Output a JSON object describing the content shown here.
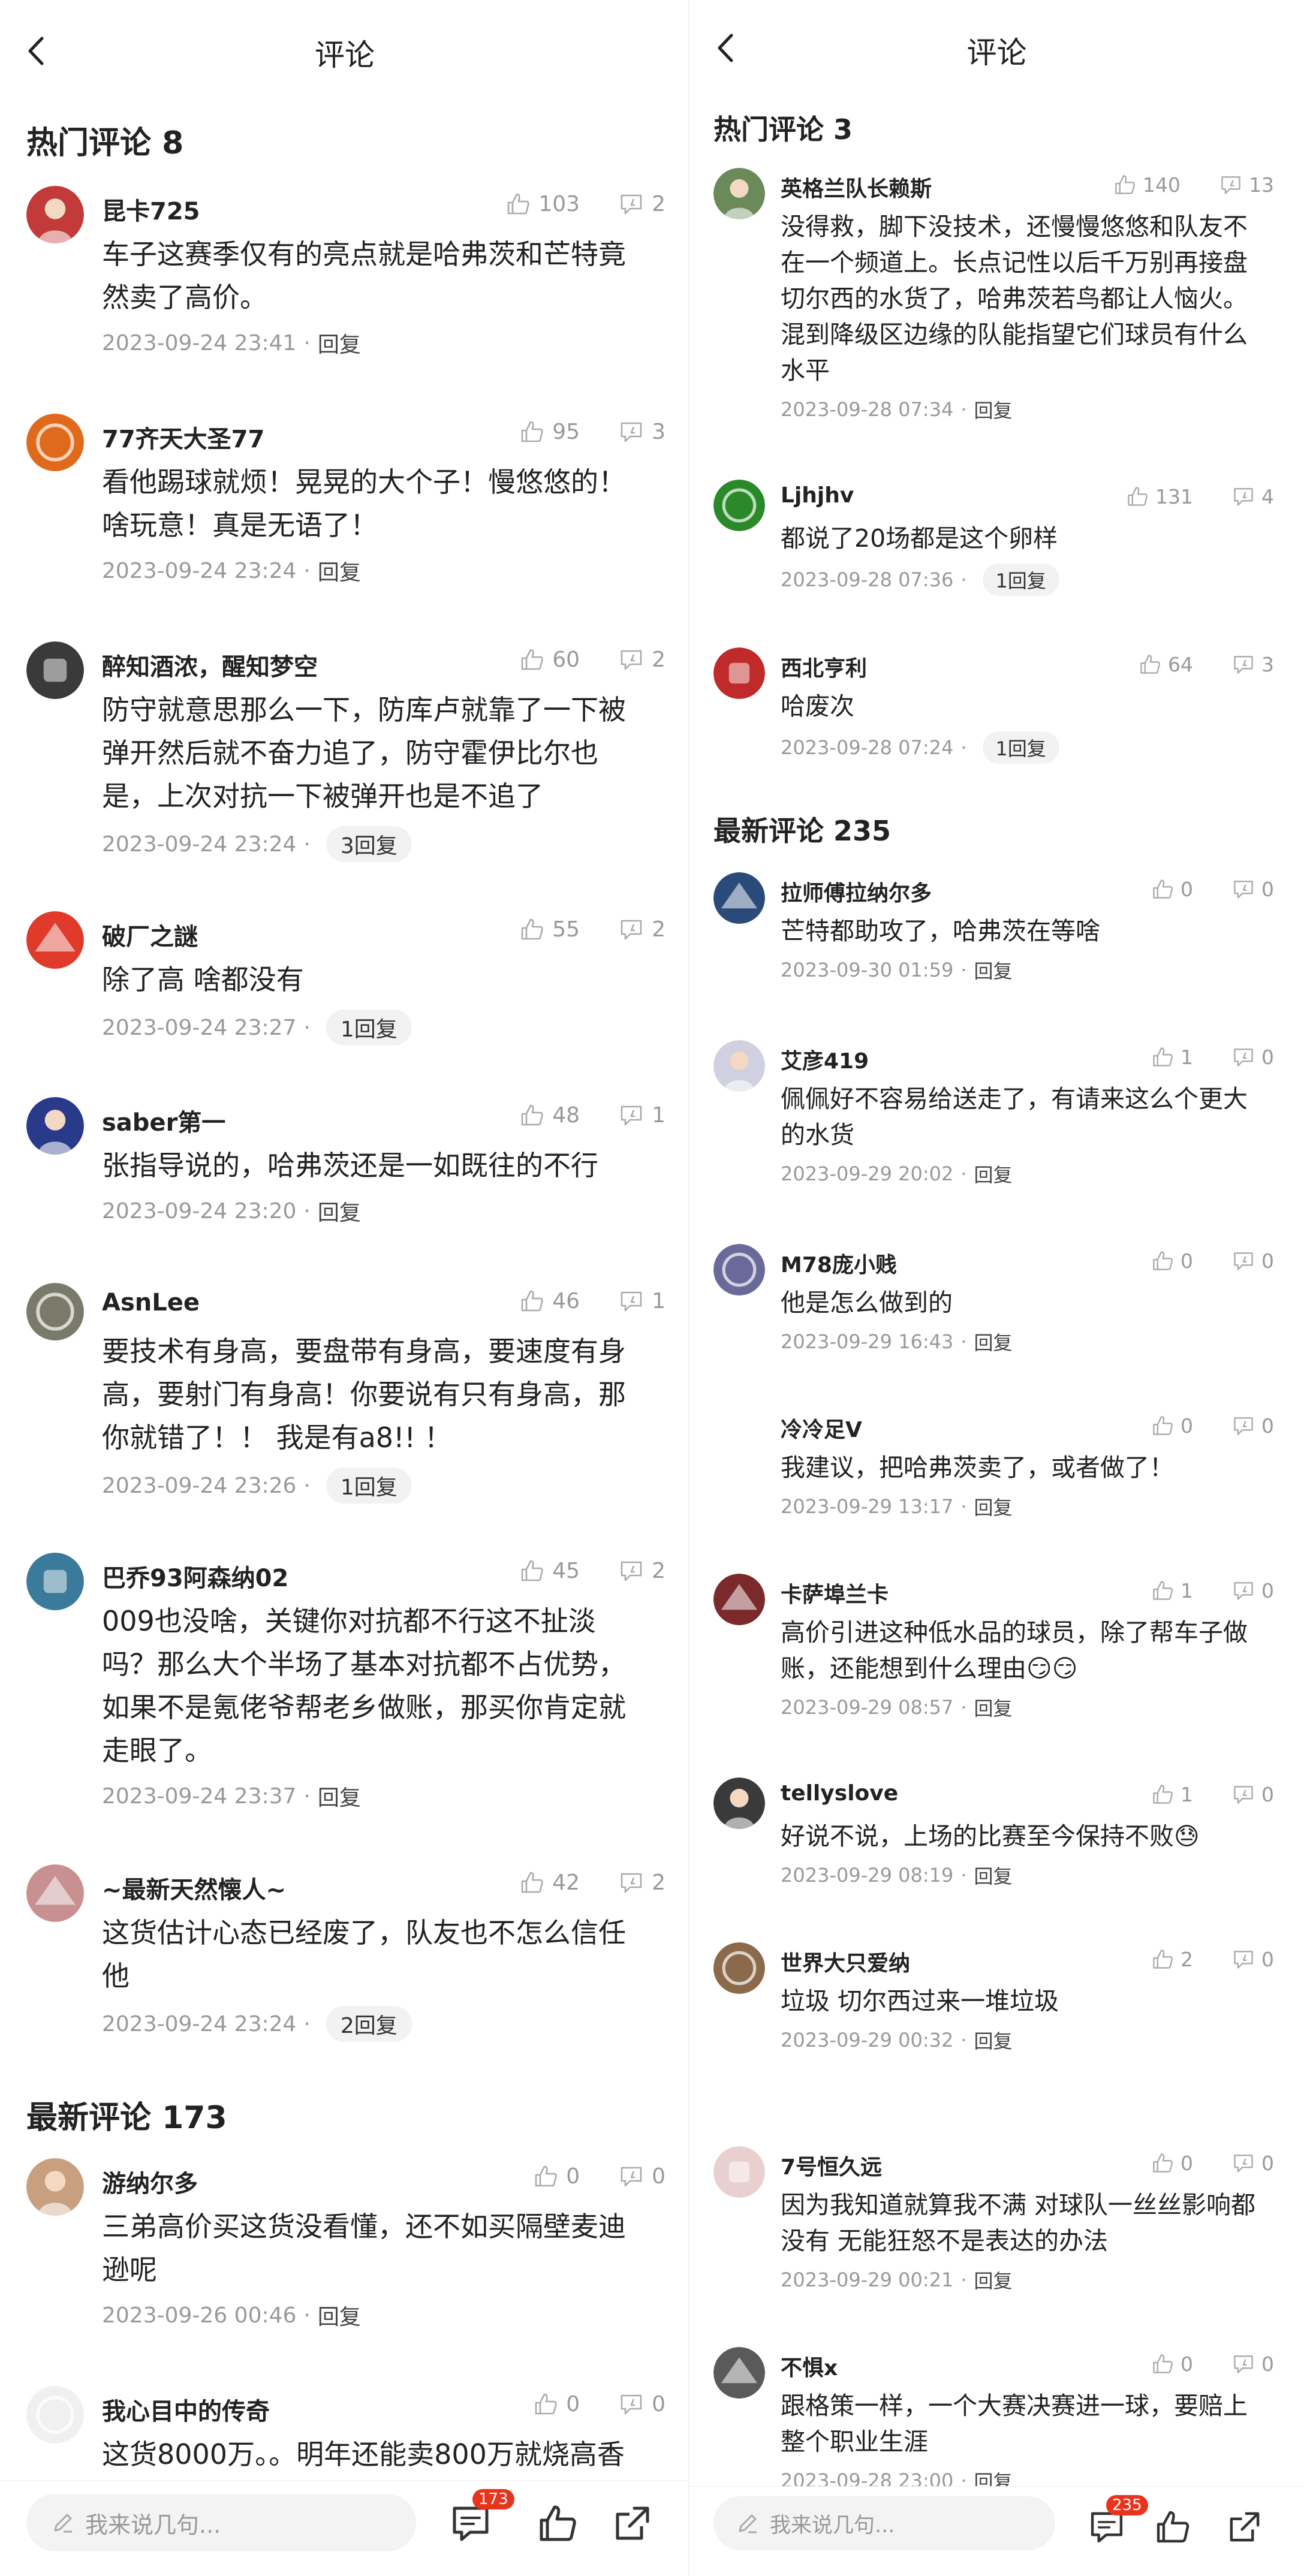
{
  "left": {
    "title": "评论",
    "hot_title": "热门评论 8",
    "new_title": "最新评论 173",
    "hot": [
      {
        "user": "昆卡725",
        "likes": "103",
        "dislikes": "2",
        "lines": [
          "车子这赛季仅有的亮点就是哈弗茨和芒特竟",
          "然卖了高价。"
        ],
        "time": "2023-09-24 23:41",
        "reply": "回复",
        "reply_count": ""
      },
      {
        "user": "77齐天大圣77",
        "likes": "95",
        "dislikes": "3",
        "lines": [
          "看他踢球就烦！晃晃的大个子！慢悠悠的！",
          "啥玩意！真是无语了！"
        ],
        "time": "2023-09-24 23:24",
        "reply": "回复",
        "reply_count": ""
      },
      {
        "user": "醉知酒浓，醒知梦空",
        "likes": "60",
        "dislikes": "2",
        "lines": [
          "防守就意思那么一下，防库卢就靠了一下被",
          "弹开然后就不奋力追了，防守霍伊比尔也",
          "是，上次对抗一下被弹开也是不追了"
        ],
        "time": "2023-09-24 23:24",
        "reply": "",
        "reply_count": "3回复"
      },
      {
        "user": "破厂之謎",
        "likes": "55",
        "dislikes": "2",
        "lines": [
          "除了高 啥都没有"
        ],
        "time": "2023-09-24 23:27",
        "reply": "",
        "reply_count": "1回复"
      },
      {
        "user": "saber第一",
        "likes": "48",
        "dislikes": "1",
        "lines": [
          "张指导说的，哈弗茨还是一如既往的不行"
        ],
        "time": "2023-09-24 23:20",
        "reply": "回复",
        "reply_count": ""
      },
      {
        "user": "AsnLee",
        "likes": "46",
        "dislikes": "1",
        "lines": [
          "要技术有身高，要盘带有身高，要速度有身",
          "高，要射门有身高！你要说有只有身高，那",
          "你就错了！！ 我是有a8!! ！"
        ],
        "time": "2023-09-24 23:26",
        "reply": "",
        "reply_count": "1回复"
      },
      {
        "user": "巴乔93阿森纳02",
        "likes": "45",
        "dislikes": "2",
        "lines": [
          "009也没啥，关键你对抗都不行这不扯淡",
          "吗？那么大个半场了基本对抗都不占优势，",
          "如果不是氪佬爷帮老乡做账，那买你肯定就",
          "走眼了。"
        ],
        "time": "2023-09-24 23:37",
        "reply": "回复",
        "reply_count": ""
      },
      {
        "user": "~最新天然懐人~",
        "likes": "42",
        "dislikes": "2",
        "lines": [
          "这货估计心态已经废了，队友也不怎么信任",
          "他"
        ],
        "time": "2023-09-24 23:24",
        "reply": "",
        "reply_count": "2回复"
      }
    ],
    "new": [
      {
        "user": "游纳尔多",
        "likes": "0",
        "dislikes": "0",
        "lines": [
          "三弟高价买这货没看懂，还不如买隔壁麦迪",
          "逊呢"
        ],
        "time": "2023-09-26 00:46",
        "reply": "回复",
        "reply_count": ""
      },
      {
        "user": "我心目中的传奇",
        "likes": "0",
        "dislikes": "0",
        "lines": [
          "这货8000万。。明年还能卖800万就烧高香"
        ],
        "time": "",
        "reply": "",
        "reply_count": ""
      }
    ],
    "input_placeholder": "我来说几句...",
    "comment_badge": "173"
  },
  "right": {
    "title": "评论",
    "hot_title": "热门评论 3",
    "new_title": "最新评论 235",
    "hot": [
      {
        "user": "英格兰队长赖斯",
        "likes": "140",
        "dislikes": "13",
        "lines": [
          "没得救，脚下没技术，还慢慢悠悠和队友不",
          "在一个频道上。长点记性以后千万别再接盘",
          "切尔西的水货了，哈弗茨若鸟都让人恼火。",
          "混到降级区边缘的队能指望它们球员有什么",
          "水平"
        ],
        "time": "2023-09-28 07:34",
        "reply": "回复",
        "reply_count": ""
      },
      {
        "user": "Ljhjhv",
        "likes": "131",
        "dislikes": "4",
        "lines": [
          "都说了20场都是这个卵样"
        ],
        "time": "2023-09-28 07:36",
        "reply": "",
        "reply_count": "1回复"
      },
      {
        "user": "西北亨利",
        "likes": "64",
        "dislikes": "3",
        "lines": [
          "哈废次"
        ],
        "time": "2023-09-28 07:24",
        "reply": "",
        "reply_count": "1回复"
      }
    ],
    "new": [
      {
        "user": "拉师傅拉纳尔多",
        "likes": "0",
        "dislikes": "0",
        "lines": [
          "芒特都助攻了，哈弗茨在等啥"
        ],
        "time": "2023-09-30 01:59",
        "reply": "回复",
        "reply_count": ""
      },
      {
        "user": "艾彦419",
        "likes": "1",
        "dislikes": "0",
        "lines": [
          "佩佩好不容易给送走了，有请来这么个更大",
          "的水货"
        ],
        "time": "2023-09-29 20:02",
        "reply": "回复",
        "reply_count": ""
      },
      {
        "user": "M78庞小贱",
        "likes": "0",
        "dislikes": "0",
        "lines": [
          "他是怎么做到的"
        ],
        "time": "2023-09-29 16:43",
        "reply": "回复",
        "reply_count": ""
      },
      {
        "user": "冷冷足V",
        "likes": "0",
        "dislikes": "0",
        "lines": [
          "我建议，把哈弗茨卖了，或者做了！"
        ],
        "time": "2023-09-29 13:17",
        "reply": "回复",
        "reply_count": ""
      },
      {
        "user": "卡萨埠兰卡",
        "likes": "1",
        "dislikes": "0",
        "lines": [
          "高价引进这种低水品的球员，除了帮车子做",
          "账，还能想到什么理由😏😏"
        ],
        "time": "2023-09-29 08:57",
        "reply": "回复",
        "reply_count": ""
      },
      {
        "user": "tellyslove",
        "likes": "1",
        "dislikes": "0",
        "lines": [
          "好说不说，上场的比赛至今保持不败😓"
        ],
        "time": "2023-09-29 08:19",
        "reply": "回复",
        "reply_count": ""
      },
      {
        "user": "世界大只爱纳",
        "likes": "2",
        "dislikes": "0",
        "lines": [
          "垃圾 切尔西过来一堆垃圾"
        ],
        "time": "2023-09-29 00:32",
        "reply": "回复",
        "reply_count": ""
      },
      {
        "user": "7号恒久远",
        "likes": "0",
        "dislikes": "0",
        "lines": [
          "因为我知道就算我不满 对球队一丝丝影响都",
          "没有 无能狂怒不是表达的办法"
        ],
        "time": "2023-09-29 00:21",
        "reply": "回复",
        "reply_count": ""
      },
      {
        "user": "不惧x",
        "likes": "0",
        "dislikes": "0",
        "lines": [
          "跟格策一样，一个大赛决赛进一球，要赔上",
          "整个职业生涯"
        ],
        "time": "2023-09-28 23:00",
        "reply": "回复",
        "reply_count": ""
      }
    ],
    "input_placeholder": "我来说几句...",
    "comment_badge": "235"
  },
  "colors": {
    "accent": "#e8341c",
    "muted": "#999999",
    "text": "#222222",
    "pill": "#f2f2f2"
  },
  "icons": [
    "back-arrow-icon",
    "like-icon",
    "dislike-icon",
    "pencil-icon",
    "comment-icon",
    "share-icon"
  ]
}
